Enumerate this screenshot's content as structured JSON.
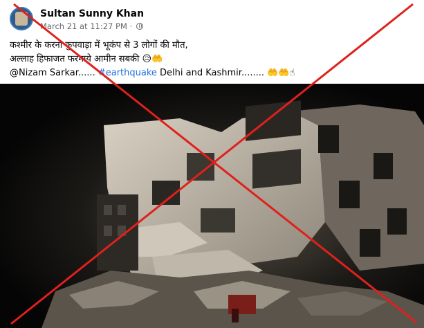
{
  "post": {
    "author": "Sultan Sunny Khan",
    "date": "March 21 at 11:27 PM",
    "meta_sep": "·",
    "visibility_icon": "globe-icon",
    "line1": "कश्मीर के करना कुपवाड़ा में भूकंप से 3 लोगों की मौत,",
    "line2": "अल्लाह हिफाजत फरमाये आमीन सबकी 😥🤲",
    "mention": "@Nizam Sarkar......",
    "hashtag": "#earthquake",
    "line3_rest": "Delhi and Kashmir........ 🤲🤲☝"
  },
  "photo": {
    "subject": "collapsed multi-storey building at night"
  },
  "overlay": {
    "mark": "red-cross",
    "color": "#e0201c"
  }
}
